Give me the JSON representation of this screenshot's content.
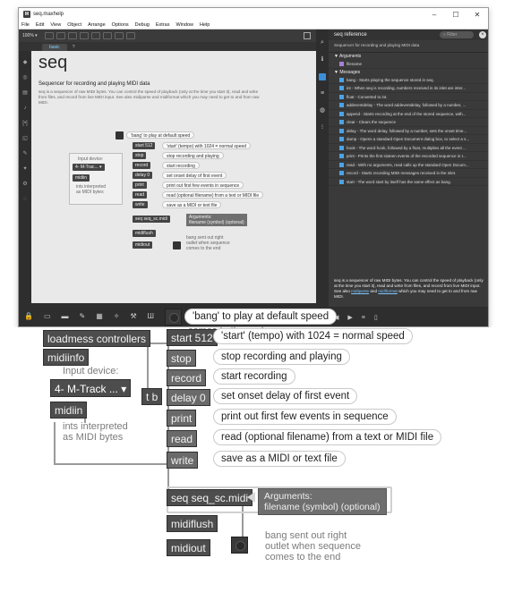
{
  "window": {
    "title": "seq.maxhelp",
    "menus": [
      "File",
      "Edit",
      "View",
      "Object",
      "Arrange",
      "Options",
      "Debug",
      "Extras",
      "Window",
      "Help"
    ],
    "min": "–",
    "max": "☐",
    "close": "✕"
  },
  "toolbar": {
    "zoom": "100% ▾"
  },
  "tabs": {
    "basic": "basic",
    "other": "?"
  },
  "help": {
    "title": "seq",
    "subtitle": "Sequencer for recording and playing MIDI data",
    "description": "seq is a sequencer of raw MIDI bytes. You can control the speed of playback (only at the time you start it), read and write from files, and record from live MIDI input. See also midiparse and midiformat which you may need to get to and from raw MIDI.",
    "mini": {
      "bang_cmt": "'bang' to play at default speed",
      "start": "start 512",
      "stop": "stop",
      "record": "record",
      "delay": "delay 0",
      "print": "print",
      "read": "read",
      "write": "write",
      "start_cmt": "'start' (tempo) with 1024 = normal speed",
      "stop_cmt": "stop recording and playing",
      "record_cmt": "start recording",
      "delay_cmt": "set onset delay of first event",
      "print_cmt": "print out first few events in sequence",
      "read_cmt": "read (optional filename) from a text or MIDI file",
      "write_cmt": "save as a MIDI or text file",
      "input_device": "Input device:",
      "dev_menu": "4- M-Trac... ▾",
      "midiin": "midiin",
      "ints": "ints interpreted\nas MIDI bytes",
      "seqobj": "seq seq_sc.midi",
      "midiflush": "midiflush",
      "midiout": "midiout",
      "arg_head": "Arguments:",
      "arg_body": "filename (symbol) (optional)",
      "bang_note": "bang sent out right\noutlet when sequence\ncomes to the end"
    }
  },
  "reference": {
    "header": "seq reference",
    "search_placeholder": "Filter",
    "desc": "Sequencer for recording and playing MIDI data",
    "args_label": "▼ Arguments",
    "arg_item": "filename",
    "msgs_label": "▼ Messages",
    "messages": [
      "bang - Starts playing the sequence stored in seq.",
      "int - When seq is recording, numbers received in its inlet are inter...",
      "float - Converted to int.",
      "addeventdelay - The word addeventdelay, followed by a number, ...",
      "append - Starts recording at the end of the stored sequence, with...",
      "clear - Clears the sequence",
      "delay - The word delay, followed by a number, sets the onset time...",
      "dump - Opens a standard Open Document dialog box, to select a s...",
      "hook - The word hook, followed by a float, multiplies all the event ...",
      "print - Prints the first sixteen events of the recorded sequence in t...",
      "read - With no arguments, read calls up the standard Open Docum...",
      "record - Starts recording MIDI messages received in the inlet.",
      "start - The word start by itself has the same effect as bang."
    ],
    "doc_text": "seq is a sequencer of raw MIDI bytes. You can control the speed of playback (only at the time you start it), read and write from files, and record from live MIDI input. See also",
    "doc_link1": "midiparse",
    "doc_and": "and",
    "doc_link2": "midiformat",
    "doc_tail": "which you may need to get to and from raw MIDI."
  },
  "zoomed": {
    "comes_to_end": "comes to the end",
    "bang_cmt": "'bang' to play at default speed",
    "loadmess": "loadmess controllers",
    "midiinfo": "midiinfo",
    "input_device": "Input device:",
    "dev_menu": "4- M-Track ... ▾",
    "midiin": "midiin",
    "ints": "ints interpreted\nas MIDI bytes",
    "tb": "t b",
    "start": "start 512",
    "stop": "stop",
    "record": "record",
    "delay": "delay 0",
    "print": "print",
    "read": "read",
    "write": "write",
    "start_cmt": "'start' (tempo) with 1024 = normal speed",
    "stop_cmt": "stop recording and playing",
    "record_cmt": "start recording",
    "delay_cmt": "set onset delay of first event",
    "print_cmt": "print out first few events in sequence",
    "read_cmt": "read (optional filename) from a text or MIDI file",
    "write_cmt": "save as a MIDI or text file",
    "seqobj": "seq seq_sc.midi",
    "arg_head": "Arguments:",
    "arg_body": "filename (symbol) (optional)",
    "midiflush": "midiflush",
    "midiout": "midiout",
    "bang_note": "bang sent out right\noutlet when sequence\ncomes to the end"
  }
}
